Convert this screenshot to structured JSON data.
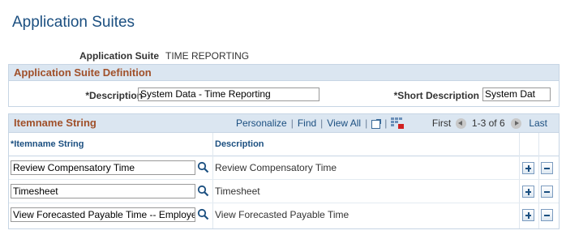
{
  "page": {
    "title": "Application Suites"
  },
  "suite": {
    "label": "Application Suite",
    "value": "TIME REPORTING"
  },
  "definition": {
    "title": "Application Suite Definition",
    "description_label": "*Description",
    "description_value": "System Data - Time Reporting",
    "short_label": "*Short Description",
    "short_value": "System Dat"
  },
  "grid": {
    "title": "Itemname String",
    "nav": {
      "personalize": "Personalize",
      "find": "Find",
      "view_all": "View All"
    },
    "pager": {
      "first": "First",
      "count": "1-3 of 6",
      "last": "Last"
    },
    "columns": {
      "itemname": "*Itemname String",
      "description": "Description"
    },
    "rows": [
      {
        "itemname": "Review Compensatory Time",
        "description": "Review Compensatory Time"
      },
      {
        "itemname": "Timesheet",
        "description": "Timesheet"
      },
      {
        "itemname": "View Forecasted Payable Time -- Employee",
        "description": "View Forecasted Payable Time"
      }
    ]
  },
  "colors": {
    "title_blue": "#1b4f80",
    "section_header_bg": "#dbe6f1",
    "section_title_brown": "#a0502a"
  },
  "icons": {
    "lookup": "search-icon",
    "zoom": "zoom-icon",
    "download": "download-icon",
    "prev": "arrow-left-icon",
    "next": "arrow-right-icon",
    "add": "plus-icon",
    "delete": "minus-icon"
  }
}
